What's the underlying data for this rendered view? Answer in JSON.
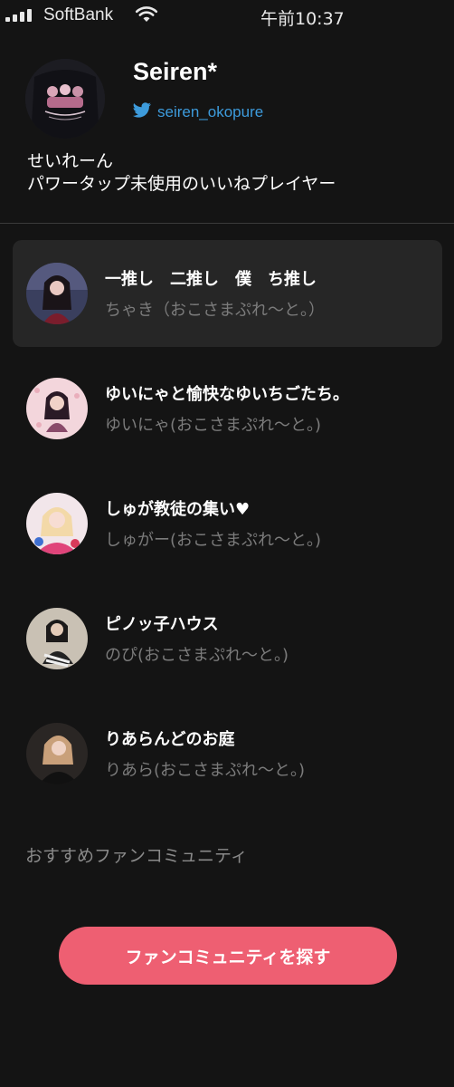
{
  "status_bar": {
    "carrier": "SoftBank",
    "time": "午前10:37"
  },
  "profile": {
    "name": "Seiren*",
    "twitter_handle": "seiren_okopure",
    "bio_line1": "せいれーん",
    "bio_line2": "パワータップ未使用のいいねプレイヤー"
  },
  "communities": [
    {
      "title": "一推し　二推し　僕　ち推し",
      "subtitle": "ちゃき（おこさまぷれ〜と。）",
      "selected": true
    },
    {
      "title": "ゆいにゃと愉快なゆいちごたち。",
      "subtitle": "ゆいにゃ(おこさまぷれ〜と。)",
      "selected": false
    },
    {
      "title": "しゅが教徒の集い♥",
      "subtitle": "しゅがー(おこさまぷれ〜と。)",
      "selected": false
    },
    {
      "title": "ピノッ子ハウス",
      "subtitle": "のぴ(おこさまぷれ〜と。)",
      "selected": false
    },
    {
      "title": "りあらんどのお庭",
      "subtitle": "りあら(おこさまぷれ〜と。)",
      "selected": false
    }
  ],
  "recommended_label": "おすすめファンコミュニティ",
  "cta_label": "ファンコミュニティを探す",
  "colors": {
    "background": "#141414",
    "twitter_blue": "#3d9bdc",
    "cta": "#ee5f72",
    "subtext": "#7b7b7b"
  },
  "icons": [
    "signal-icon",
    "wifi-icon",
    "twitter-bird-icon"
  ]
}
